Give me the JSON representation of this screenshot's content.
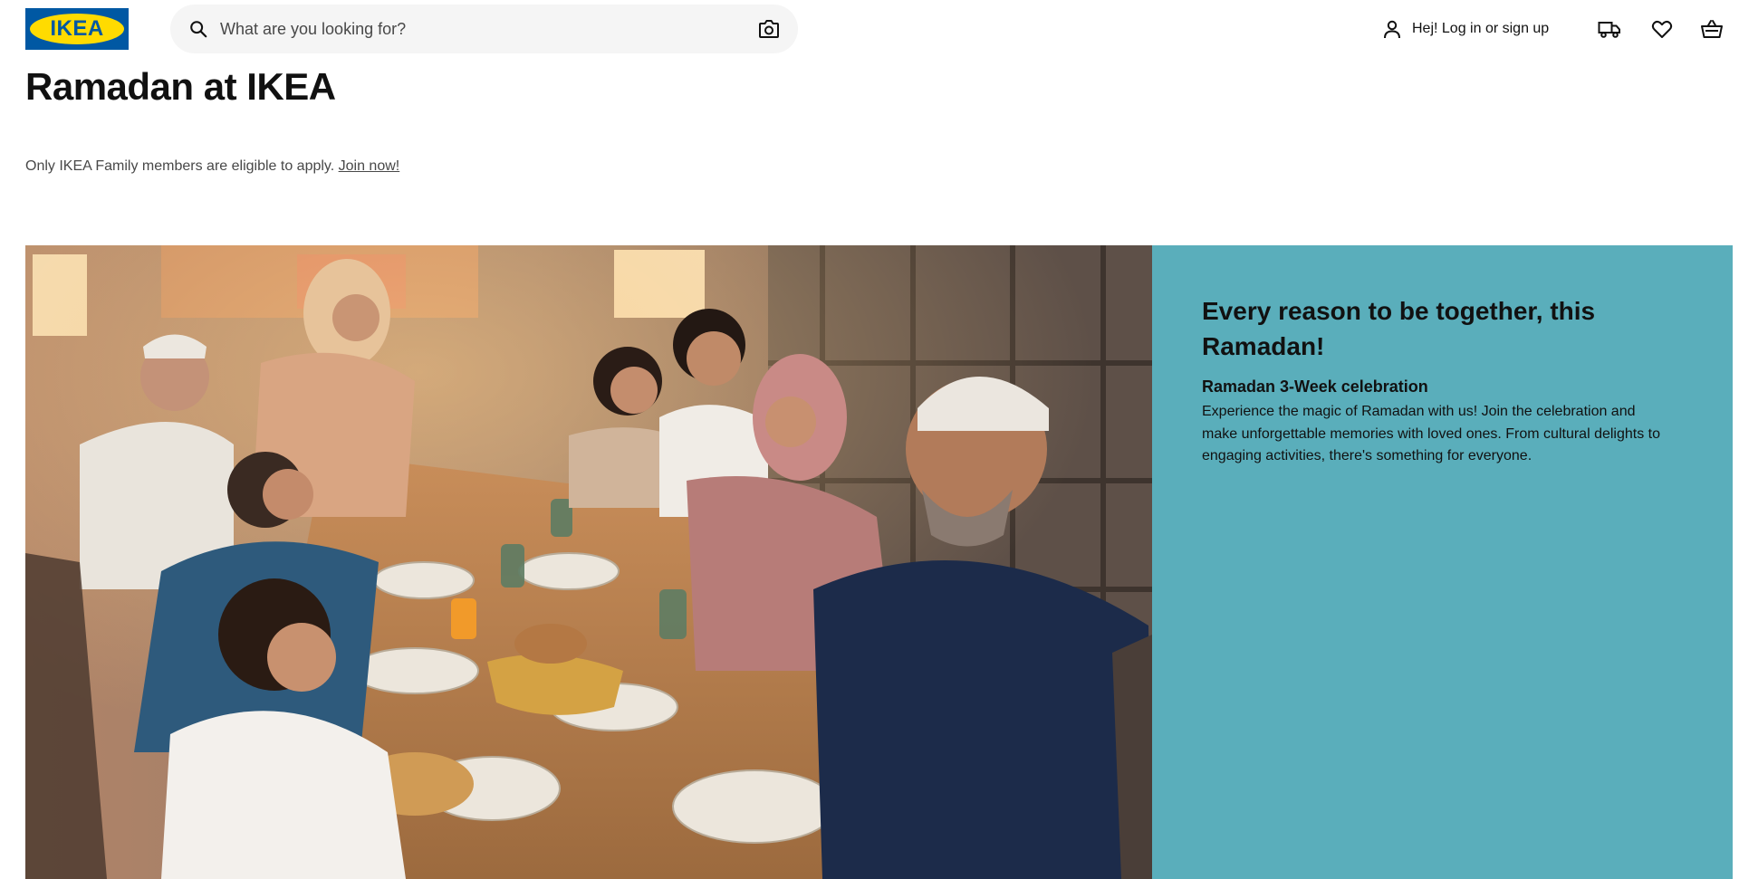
{
  "header": {
    "logo_text": "IKEA",
    "search_placeholder": "What are you looking for?",
    "account_label": "Hej! Log in or sign up",
    "icons": [
      "search-icon",
      "camera-icon",
      "person-icon",
      "truck-icon",
      "heart-icon",
      "basket-icon"
    ]
  },
  "page": {
    "title": "Ramadan at IKEA",
    "notice_text": "Only IKEA Family members are eligible to apply.",
    "notice_link": "Join now!"
  },
  "hero": {
    "heading": "Every reason to be together, this Ramadan!",
    "subheading": "Ramadan 3-Week celebration",
    "body": "Experience the magic of Ramadan with us! Join the celebration and make unforgettable memories with loved ones. From cultural delights to engaging activities, there's something for everyone.",
    "panel_color": "#5aaebb"
  },
  "colors": {
    "brand_blue": "#0058a3",
    "brand_yellow": "#ffdb00"
  }
}
